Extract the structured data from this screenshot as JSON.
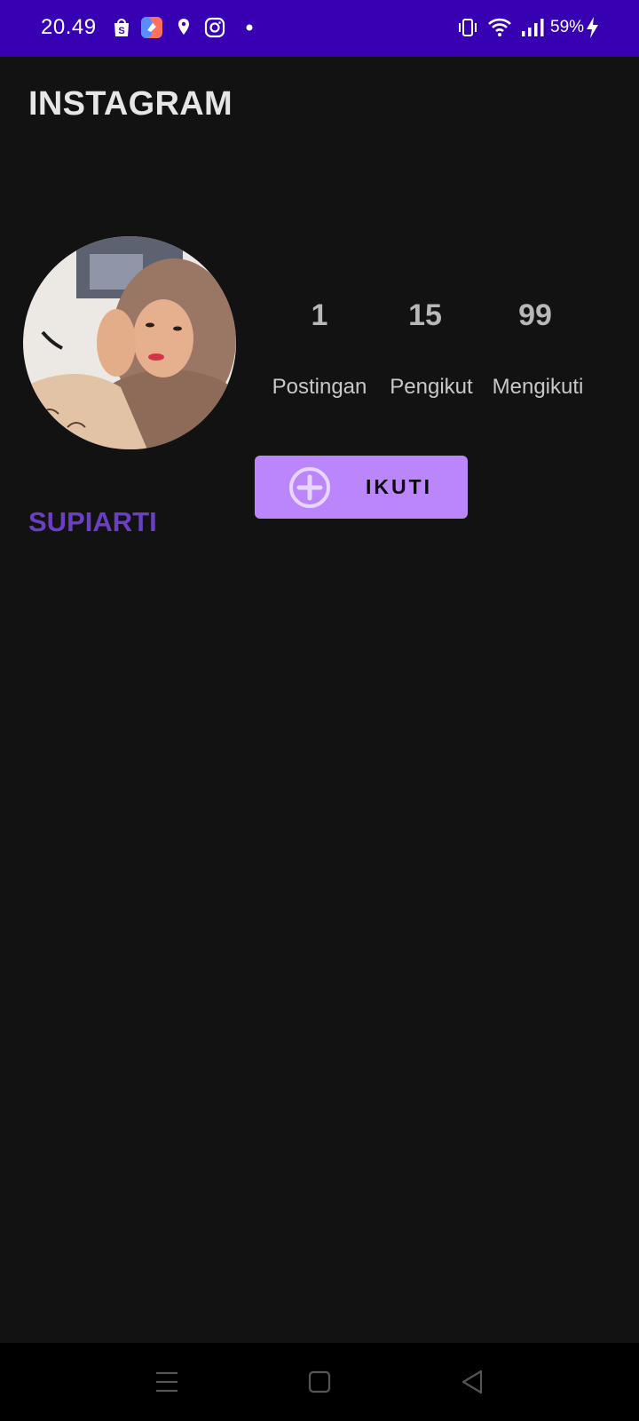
{
  "status_bar": {
    "time": "20.49",
    "battery": "59%",
    "icons": [
      "shopee-icon",
      "app-icon",
      "location-icon",
      "instagram-icon",
      "dot-icon",
      "vibrate-icon",
      "wifi-icon",
      "signal-icon",
      "charging-icon"
    ],
    "background": "#3700b3"
  },
  "header": {
    "title": "INSTAGRAM"
  },
  "profile": {
    "username": "SUPIARTI",
    "username_color": "#6a3fc2",
    "stats": [
      {
        "value": "1",
        "label": "Postingan"
      },
      {
        "value": "15",
        "label": "Pengikut"
      },
      {
        "value": "99",
        "label": "Mengikuti"
      }
    ],
    "follow_button": {
      "label": "IKUTI",
      "icon": "plus-circle-icon",
      "color": "#bb86fc"
    }
  },
  "nav_bar": {
    "buttons": [
      "menu-icon",
      "home-icon",
      "back-icon"
    ]
  }
}
